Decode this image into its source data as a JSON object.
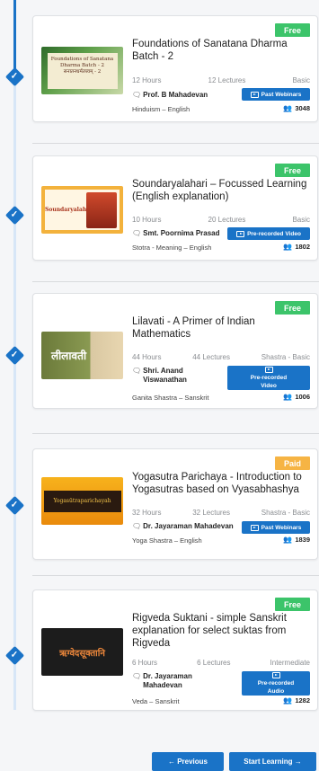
{
  "courses": [
    {
      "badge": "Free",
      "title": "Foundations of Sanatana Dharma Batch - 2",
      "hours": "12 Hours",
      "lectures": "12 Lectures",
      "level": "Basic",
      "instructor": "Prof. B Mahadevan",
      "category": "Hinduism – English",
      "type": "Past Webinars",
      "learners": "3048",
      "thumb_text": "Foundations of Sanatana Dharma Batch - 2 सनातनधर्मतत्त्वम् - 2"
    },
    {
      "badge": "Free",
      "title": "Soundaryalahari – Focussed Learning (English explanation)",
      "hours": "10 Hours",
      "lectures": "20 Lectures",
      "level": "Basic",
      "instructor": "Smt. Poornima Prasad",
      "category": "Stotra - Meaning – English",
      "type": "Pre-recorded Video",
      "learners": "1802",
      "thumb_text": "Soundaryalahari"
    },
    {
      "badge": "Free",
      "title": "Lilavati - A Primer of Indian Mathematics",
      "hours": "44 Hours",
      "lectures": "44 Lectures",
      "level": "Shastra - Basic",
      "instructor": "Shri. Anand Viswanathan",
      "category": "Ganita Shastra – Sanskrit",
      "type": "Pre-recorded Video",
      "learners": "1006",
      "thumb_text": "लीलावती"
    },
    {
      "badge": "Paid",
      "title": "Yogasutra Parichaya - Introduction to Yogasutras based on Vyasabhashya",
      "hours": "32 Hours",
      "lectures": "32 Lectures",
      "level": "Shastra - Basic",
      "instructor": "Dr. Jayaraman Mahadevan",
      "category": "Yoga Shastra – English",
      "type": "Past Webinars",
      "learners": "1839",
      "thumb_text": "Yogasūtraparichayah"
    },
    {
      "badge": "Free",
      "title": "Rigveda Suktani - simple Sanskrit explanation for select suktas from Rigveda",
      "hours": "6 Hours",
      "lectures": "6 Lectures",
      "level": "Intermediate",
      "instructor": "Dr. Jayaraman Mahadevan",
      "category": "Veda – Sanskrit",
      "type": "Pre-recorded Audio",
      "learners": "1282",
      "thumb_text": "ऋग्वेदसूक्तानि"
    }
  ],
  "nav": {
    "previous": "← Previous",
    "start": "Start Learning →"
  },
  "colors": {
    "accent": "#1a73c7",
    "free_badge": "#3cc46a",
    "paid_badge": "#f6b444"
  },
  "icons": {
    "check": "check-diamond-icon",
    "instructor": "chat-bubble-icon",
    "learners": "users-icon",
    "type": "play-icon"
  }
}
